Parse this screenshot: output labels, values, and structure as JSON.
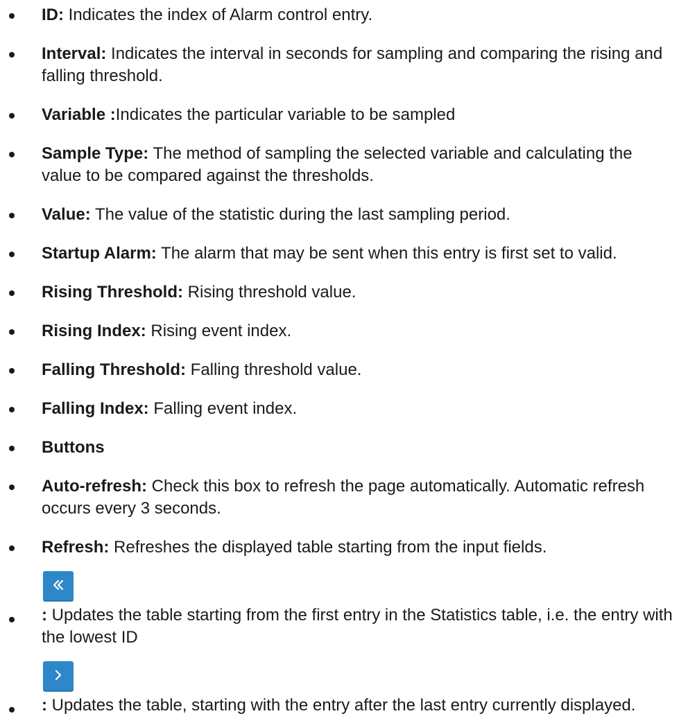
{
  "items": [
    {
      "term": "ID:",
      "text": " Indicates the index of Alarm control entry."
    },
    {
      "term": "Interval:",
      "text": " Indicates the interval in seconds for sampling and comparing the rising and falling threshold."
    },
    {
      "term": "Variable :",
      "text": "Indicates the particular variable to be sampled"
    },
    {
      "term": "Sample Type:",
      "text": " The method of sampling the selected variable and calculating the value to be compared against the thresholds."
    },
    {
      "term": "Value:",
      "text": " The value of the statistic during the last sampling period."
    },
    {
      "term": "Startup Alarm:",
      "text": " The alarm that may be sent when this entry is first set to valid."
    },
    {
      "term": "Rising Threshold:",
      "text": " Rising threshold value."
    },
    {
      "term": "Rising Index:",
      "text": " Rising event index."
    },
    {
      "term": "Falling Threshold:",
      "text": " Falling threshold value."
    },
    {
      "term": "Falling Index:",
      "text": " Falling event index."
    },
    {
      "term": "Buttons",
      "text": ""
    },
    {
      "term": "Auto-refresh:",
      "text": " Check this box to refresh the page automatically. Automatic refresh occurs every 3 seconds."
    },
    {
      "term": "Refresh:",
      "text": " Refreshes the displayed table starting from the input fields."
    }
  ],
  "button_items": [
    {
      "icon": "double-chevron-left-icon",
      "term": ":",
      "text": " Updates the table starting from the first entry in the Statistics table, i.e. the entry with the lowest ID"
    },
    {
      "icon": "chevron-right-icon",
      "term": ":",
      "text": " Updates the table, starting with the entry after the last entry currently displayed."
    }
  ],
  "colors": {
    "button_bg": "#2d87c9",
    "icon": "#ffffff",
    "text": "#1a1a1a"
  }
}
